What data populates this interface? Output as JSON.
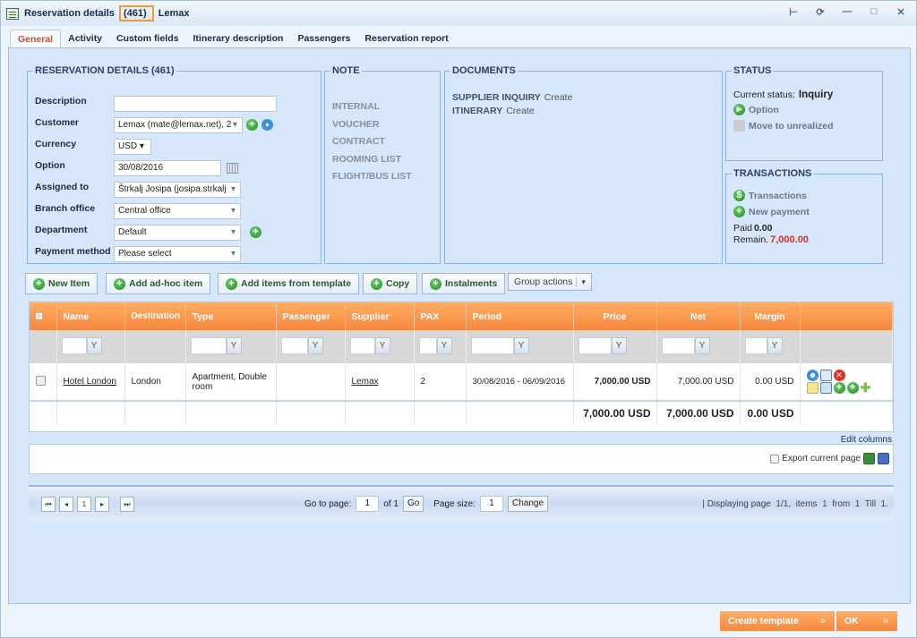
{
  "window": {
    "title_prefix": "Reservation details",
    "title_number": "(461)",
    "title_suffix": "Lemax",
    "controls": [
      "pin-icon",
      "refresh-icon",
      "minimize-icon",
      "maximize-icon",
      "close-icon"
    ]
  },
  "tabs": [
    {
      "label": "General",
      "active": true
    },
    {
      "label": "Activity"
    },
    {
      "label": "Custom fields"
    },
    {
      "label": "Itinerary description"
    },
    {
      "label": "Passengers"
    },
    {
      "label": "Reservation report"
    }
  ],
  "details": {
    "legend": "RESERVATION DETAILS (461)",
    "description": {
      "label": "Description",
      "value": ""
    },
    "customer": {
      "label": "Customer",
      "value": "Lemax (mate@lemax.net), 2"
    },
    "currency": {
      "label": "Currency",
      "value": "USD"
    },
    "option": {
      "label": "Option",
      "value": "30/08/2016"
    },
    "assigned_to": {
      "label": "Assigned to",
      "value": "Štrkalj Josipa (josipa.strkalj"
    },
    "branch_office": {
      "label": "Branch office",
      "value": "Central office"
    },
    "department": {
      "label": "Department",
      "value": "Default"
    },
    "payment_method": {
      "label": "Payment method",
      "value": "Please select"
    }
  },
  "note": {
    "legend": "NOTE",
    "items": [
      "INTERNAL",
      "VOUCHER",
      "CONTRACT",
      "ROOMING LIST",
      "FLIGHT/BUS LIST"
    ]
  },
  "documents": {
    "legend": "DOCUMENTS",
    "items": [
      {
        "name": "SUPPLIER INQUIRY",
        "action": "Create"
      },
      {
        "name": "ITINERARY",
        "action": "Create"
      }
    ]
  },
  "status": {
    "legend": "STATUS",
    "current_label": "Current status:",
    "current_value": "Inquiry",
    "option_link": "Option",
    "unrealized_link": "Move to unrealized"
  },
  "transactions": {
    "legend": "TRANSACTIONS",
    "transactions_link": "Transactions",
    "new_payment_link": "New payment",
    "paid_label": "Paid",
    "paid_value": "0.00",
    "remain_label": "Remain.",
    "remain_value": "7,000.00",
    "remain_color": "#c0392b"
  },
  "toolbar": {
    "new_item": "New Item",
    "add_adhoc": "Add ad-hoc item",
    "add_from_template": "Add items from template",
    "copy": "Copy",
    "instalments": "Instalments",
    "group_actions": "Group actions"
  },
  "grid": {
    "columns": [
      "Name",
      "Destination",
      "Type",
      "Passenger",
      "Supplier",
      "PAX",
      "Period",
      "Price",
      "Net",
      "Margin"
    ],
    "rows": [
      {
        "name": "Hotel London",
        "destination": "London",
        "type": "Apartment, Double room",
        "passenger": "",
        "supplier": "Lemax",
        "pax": "2",
        "period": "30/08/2016 - 06/09/2016",
        "price": "7,000.00 USD",
        "net": "7,000.00 USD",
        "margin": "0.00 USD"
      }
    ],
    "totals": {
      "price": "7,000.00 USD",
      "net": "7,000.00 USD",
      "margin": "0.00 USD"
    },
    "edit_columns": "Edit columns",
    "export_label": "Export current page"
  },
  "pager": {
    "current_page": "1",
    "goto_label": "Go to page:",
    "goto_value": "1",
    "of_label": "of 1",
    "go_button": "Go",
    "page_size_label": "Page size:",
    "page_size_value": "1",
    "change_button": "Change",
    "display_info": "| Displaying page  1/1,  items  1  from  1  Till  1."
  },
  "footer": {
    "create_template": "Create template",
    "ok": "OK"
  },
  "colors": {
    "accent_orange": "#f7873e",
    "panel_bg": "#d6e6fb",
    "legend_text": "#2a3f6e"
  }
}
